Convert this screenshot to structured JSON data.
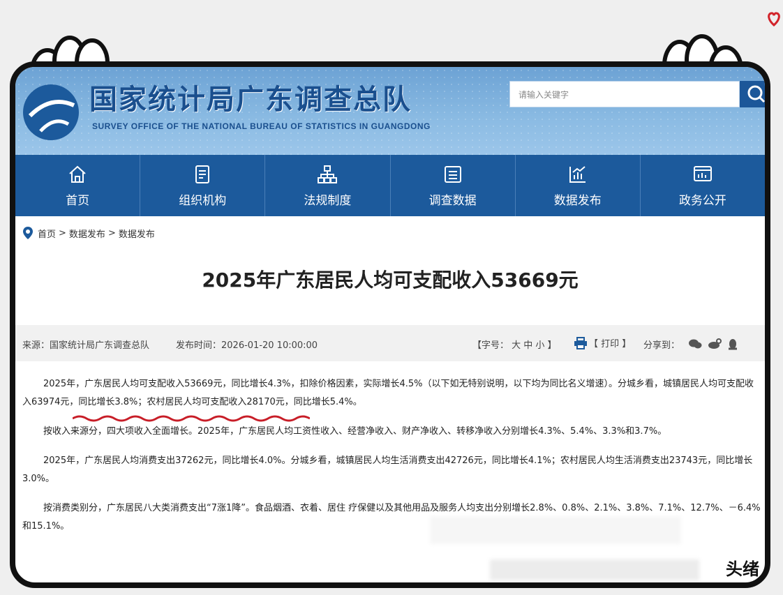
{
  "site": {
    "title": "国家统计局广东调查总队",
    "subtitle": "SURVEY OFFICE OF THE NATIONAL BUREAU OF STATISTICS IN GUANGDONG",
    "search_placeholder": "请输入关键字"
  },
  "nav": {
    "items": [
      {
        "label": "首页",
        "icon": "home-icon"
      },
      {
        "label": "组织机构",
        "icon": "document-icon"
      },
      {
        "label": "法规制度",
        "icon": "org-chart-icon"
      },
      {
        "label": "调查数据",
        "icon": "list-icon"
      },
      {
        "label": "数据发布",
        "icon": "chart-icon"
      },
      {
        "label": "政务公开",
        "icon": "browser-icon"
      }
    ]
  },
  "breadcrumb": {
    "items": [
      "首页",
      "数据发布",
      "数据发布"
    ],
    "separator": ">"
  },
  "article": {
    "title": "2025年广东居民人均可支配收入53669元",
    "source": "来源：国家统计局广东调查总队",
    "time": "发布时间：2026-01-20 10:00:00",
    "font_size": "【字号： 大 中 小 】",
    "print": "【 打印 】",
    "share": "分享到：",
    "paragraphs": [
      "2025年，广东居民人均可支配收入53669元，同比增长4.3%，扣除价格因素，实际增长4.5%（以下如无特别说明，以下均为同比名义增速）。分城乡看，城镇居民人均可支配收入63974元，同比增长3.8%；农村居民人均可支配收入28170元，同比增长5.4%。",
      "按收入来源分，四大项收入全面增长。2025年，广东居民人均工资性收入、经营净收入、财产净收入、转移净收入分别增长4.3%、5.4%、3.3%和3.7%。",
      "2025年，广东居民人均消费支出37262元，同比增长4.0%。分城乡看，城镇居民人均生活消费支出42726元，同比增长4.1%；农村居民人均生活消费支出23743元，同比增长3.0%。",
      "按消费类别分，广东居民八大类消费支出“7涨1降”。食品烟酒、衣着、居住                                         疗保健以及其他用品及服务人均支出分别增长2.8%、0.8%、2.1%、3.8%、7.1%、12.7%、－6.4%和15.1%。"
    ]
  },
  "watermark": "头绪",
  "colors": {
    "nav": "#1c5a9c",
    "banner": "#7fb0de",
    "underline": "#c81e28"
  }
}
